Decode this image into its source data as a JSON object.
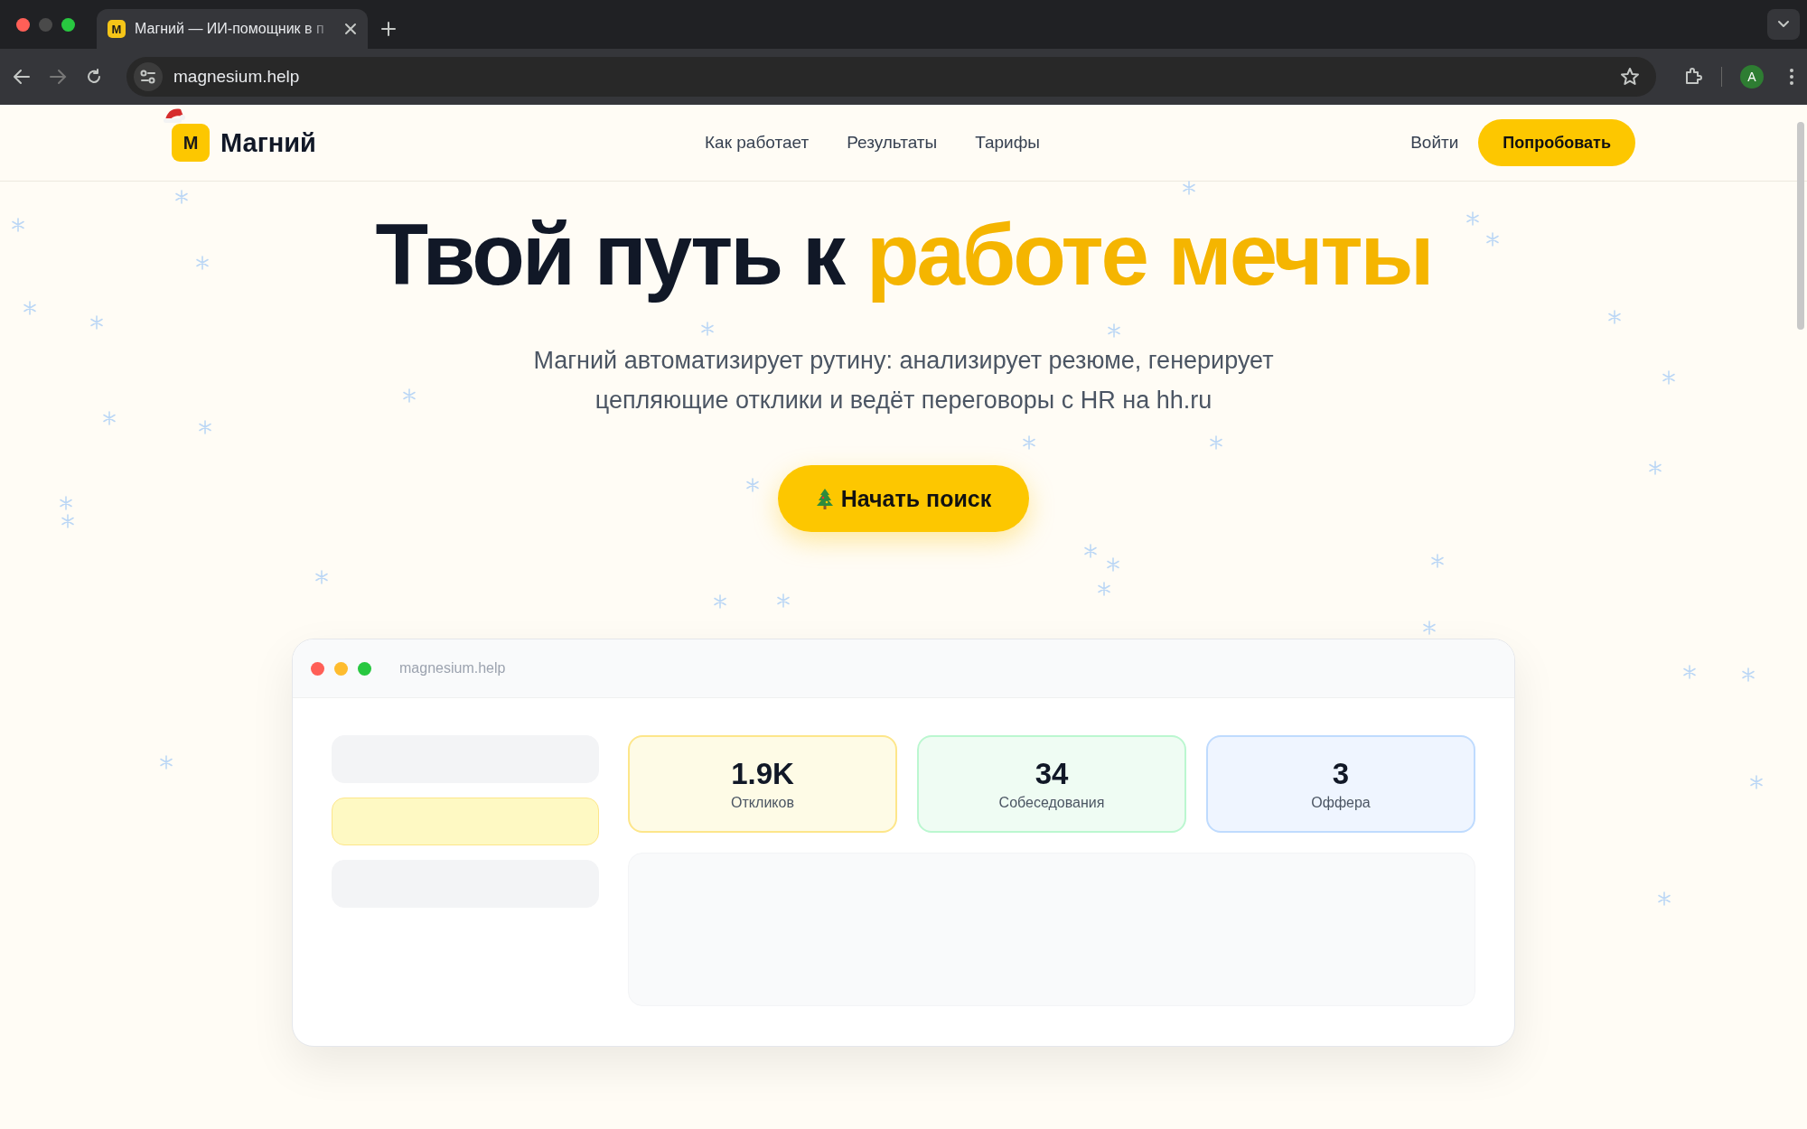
{
  "browser": {
    "tab_favicon": "М",
    "tab_title": "Магний — ИИ-помощник в п",
    "url": "magnesium.help",
    "profile_initial": "A"
  },
  "header": {
    "logo_letter": "М",
    "brand": "Магний",
    "nav": [
      "Как работает",
      "Результаты",
      "Тарифы"
    ],
    "login": "Войти",
    "cta": "Попробовать"
  },
  "hero": {
    "title_start": "Твой путь к",
    "title_highlight": "работе мечты",
    "subtitle": "Магний автоматизирует рутину: анализирует резюме, генерирует цепляющие отклики и ведёт переговоры с HR на hh.ru",
    "cta": "Начать поиск"
  },
  "preview": {
    "url": "magnesium.help",
    "sidebar": [
      {
        "selected": false
      },
      {
        "selected": true
      },
      {
        "selected": false
      }
    ],
    "stats": [
      {
        "value": "1.9K",
        "label": "Откликов",
        "color": "#fde68a"
      },
      {
        "value": "34",
        "label": "Собеседования",
        "color": "#bbf7d0"
      },
      {
        "value": "3",
        "label": "Оффера",
        "color": "#bfdbfe"
      }
    ]
  }
}
